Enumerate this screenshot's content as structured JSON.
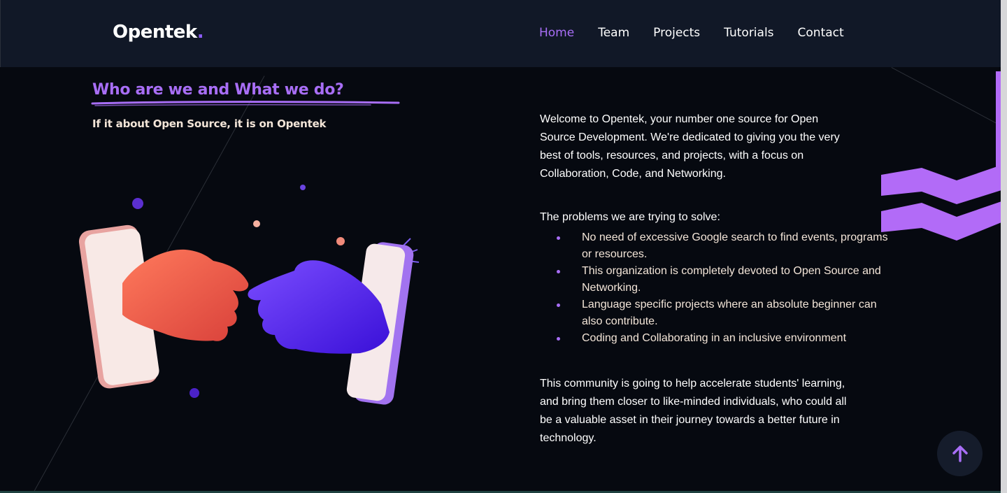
{
  "brand": {
    "name": "Opentek",
    "dot": ".",
    "accent": "#a86ef6"
  },
  "nav": {
    "items": [
      {
        "label": "Home",
        "active": true
      },
      {
        "label": "Team",
        "active": false
      },
      {
        "label": "Projects",
        "active": false
      },
      {
        "label": "Tutorials",
        "active": false
      },
      {
        "label": "Contact",
        "active": false
      }
    ]
  },
  "about": {
    "title": "Who are we and What we do?",
    "subtitle": "If it about Open Source, it is on Opentek",
    "intro": "Welcome to Opentek, your number one source for Open Source Development. We're dedicated to giving you the very best of tools, resources, and projects, with a focus on Collaboration, Code, and Networking.",
    "problems_title": "The problems we are trying to solve:",
    "problems": [
      "No need of excessive Google search to find events, programs or resources.",
      "This organization is completely devoted to Open Source and Networking.",
      "Language specific projects where an absolute beginner can also contribute.",
      "Coding and Collaborating in an inclusive environment"
    ],
    "closing": "This community is going to help accelerate students' learning, and bring them closer to like-minded individuals, who could all be a valuable asset in their journey towards a better future in technology."
  },
  "icons": {
    "scroll_top": "arrow-up-icon",
    "illustration": "handshake-phones-illustration",
    "decoration": "zigzag-decoration"
  },
  "colors": {
    "navbar_bg": "#111827",
    "page_bg": "#060910",
    "purple": "#a86ef6",
    "cream": "#f3e5d8"
  }
}
